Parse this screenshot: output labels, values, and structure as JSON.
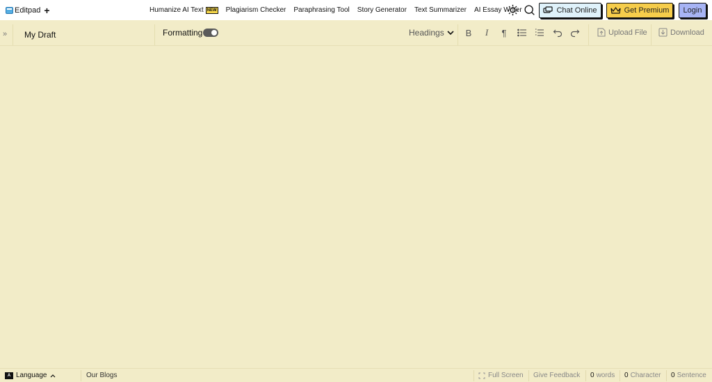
{
  "app": {
    "logo_text": "Editpad",
    "plus_label": "+"
  },
  "nav": {
    "items": [
      {
        "label": "Humanize AI Text",
        "badge": "NEW"
      },
      {
        "label": "Plagiarism Checker"
      },
      {
        "label": "Paraphrasing Tool"
      },
      {
        "label": "Story Generator"
      },
      {
        "label": "Text Summarizer"
      },
      {
        "label": "AI Essay Writer"
      }
    ]
  },
  "header_actions": {
    "chat_label": "Chat Online",
    "premium_label": "Get Premium",
    "login_label": "Login",
    "icons": [
      "sun-icon",
      "search-icon",
      "chat-icon",
      "crown-icon"
    ]
  },
  "editor": {
    "draft_title": "My Draft",
    "formatting_label": "Formatting",
    "formatting_enabled": true,
    "headings_label": "Headings",
    "tools": [
      "bold-icon",
      "italic-icon",
      "paragraph-icon",
      "bullet-list-icon",
      "numbered-list-icon",
      "undo-icon",
      "redo-icon"
    ],
    "upload_label": "Upload File",
    "download_label": "Download"
  },
  "footer": {
    "language_label": "Language",
    "blogs_label": "Our Blogs",
    "fullscreen_label": "Full Screen",
    "feedback_label": "Give Feedback",
    "words_count": "0",
    "words_label": "words",
    "character_count": "0",
    "character_label": "Character",
    "sentence_count": "0",
    "sentence_label": "Sentence"
  },
  "colors": {
    "background": "#f2ecc8",
    "chat_button": "#dff2fb",
    "premium_button": "#f6cd4b",
    "login_button": "#a7b4f5",
    "new_badge": "#f6d74a"
  }
}
